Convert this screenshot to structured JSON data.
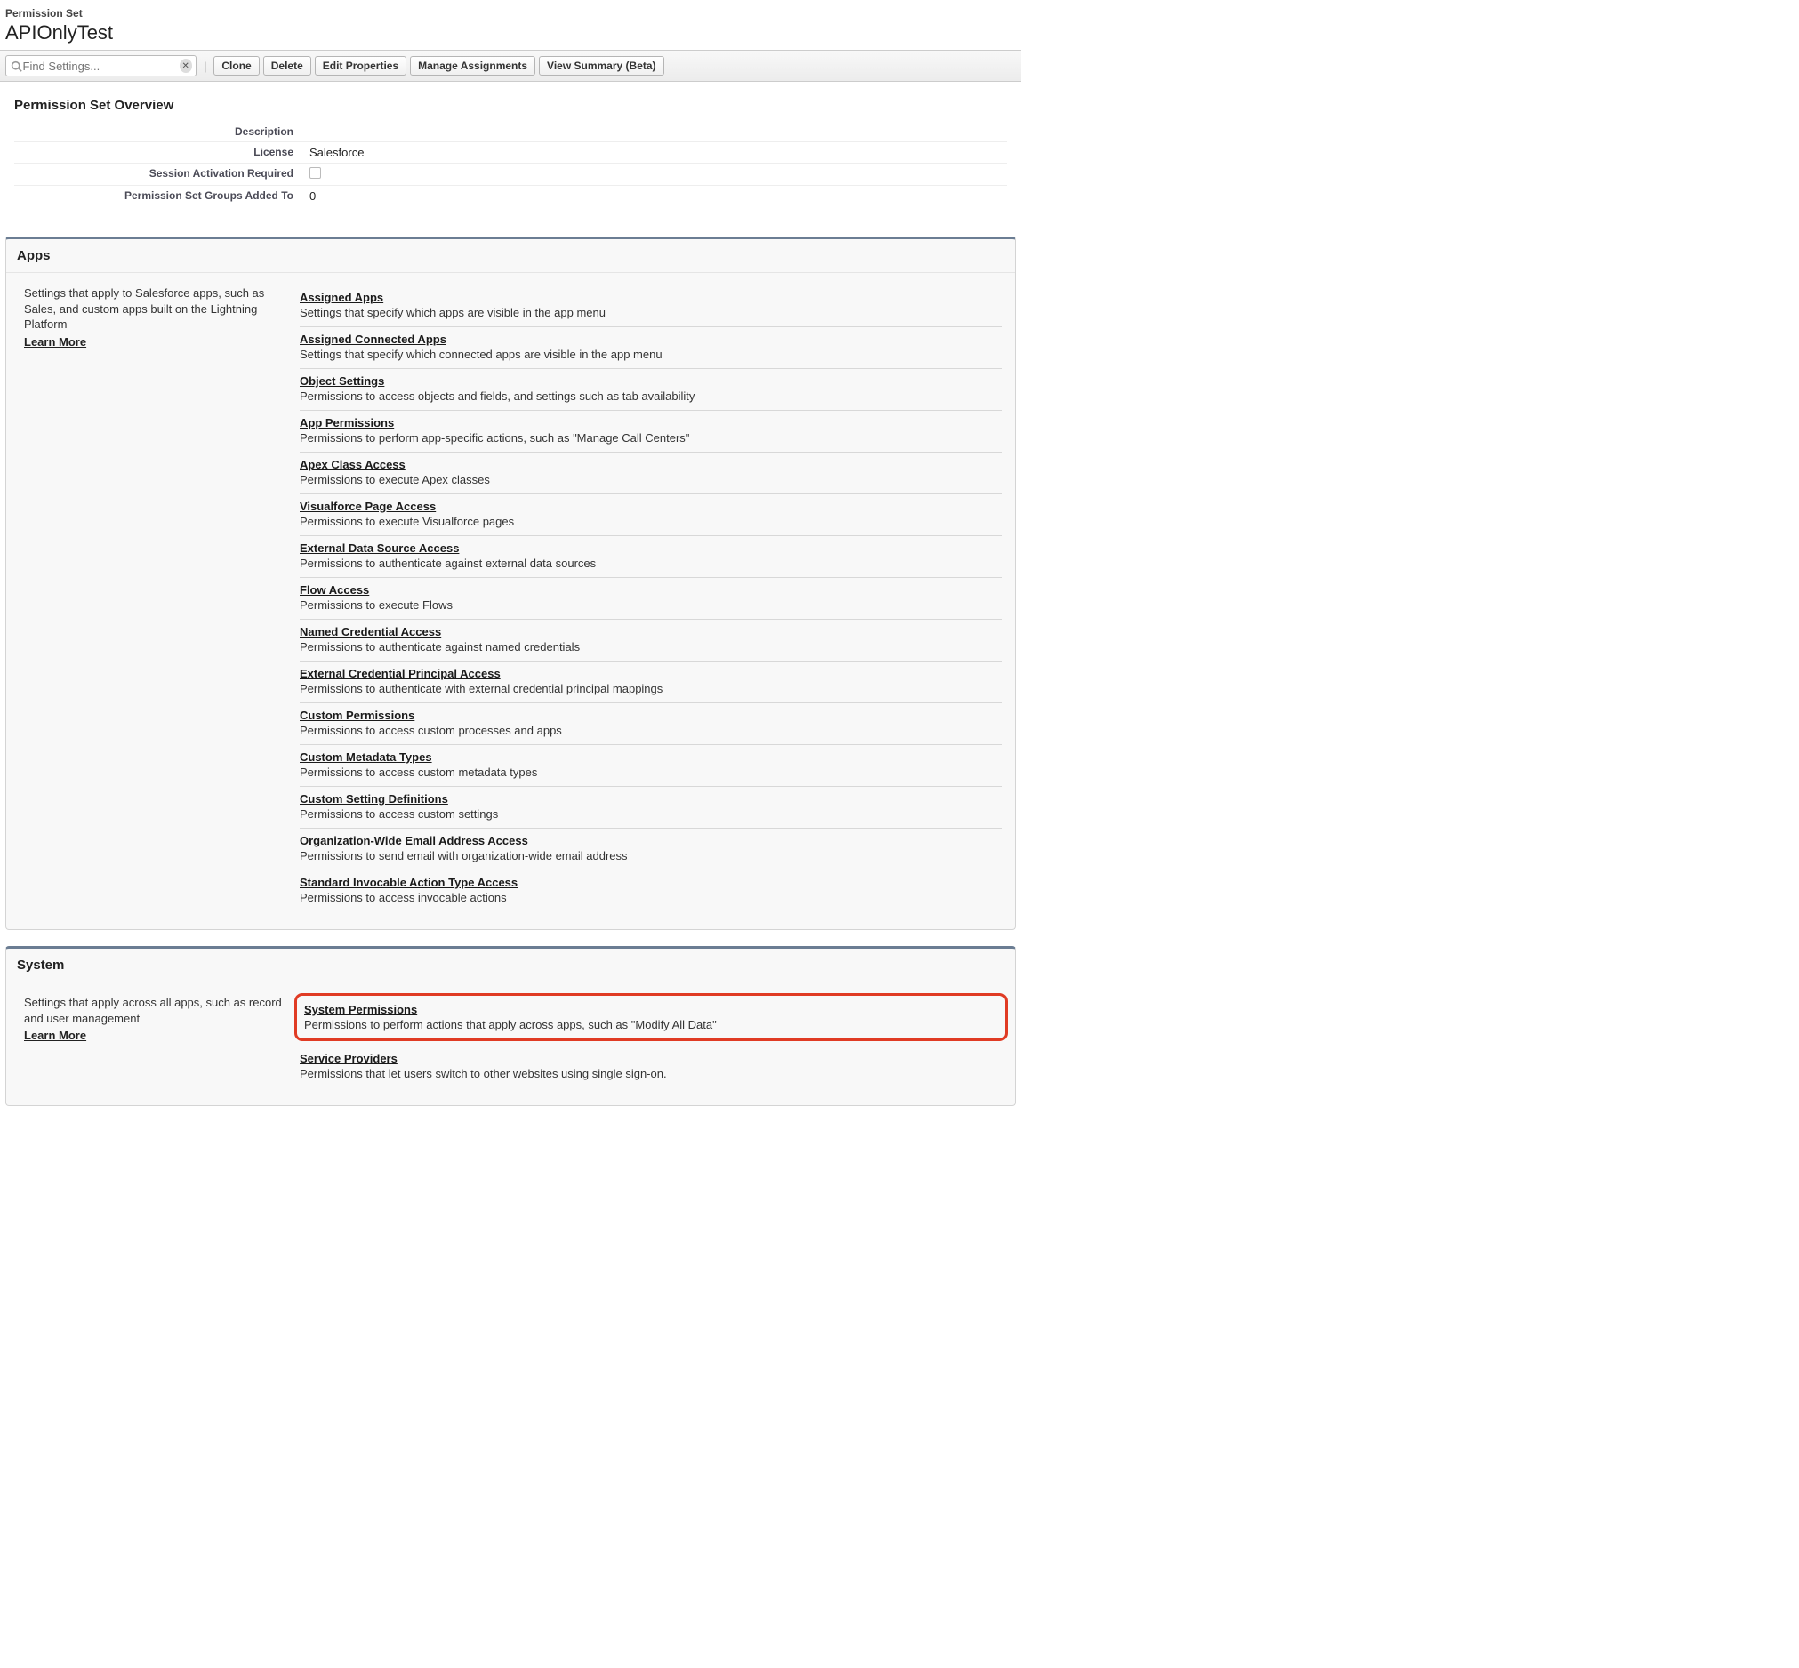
{
  "header": {
    "type_label": "Permission Set",
    "title": "APIOnlyTest"
  },
  "search": {
    "placeholder": "Find Settings..."
  },
  "toolbar": {
    "clone": "Clone",
    "delete": "Delete",
    "edit_properties": "Edit Properties",
    "manage_assignments": "Manage Assignments",
    "view_summary": "View Summary (Beta)"
  },
  "overview": {
    "heading": "Permission Set Overview",
    "rows": {
      "description_label": "Description",
      "description_value": "",
      "license_label": "License",
      "license_value": "Salesforce",
      "session_label": "Session Activation Required",
      "groups_label": "Permission Set Groups Added To",
      "groups_value": "0"
    }
  },
  "apps_section": {
    "heading": "Apps",
    "desc": "Settings that apply to Salesforce apps, such as Sales, and custom apps built on the Lightning Platform",
    "learn_more": "Learn More",
    "items": [
      {
        "title": "Assigned Apps",
        "desc": "Settings that specify which apps are visible in the app menu"
      },
      {
        "title": "Assigned Connected Apps",
        "desc": "Settings that specify which connected apps are visible in the app menu"
      },
      {
        "title": "Object Settings",
        "desc": "Permissions to access objects and fields, and settings such as tab availability"
      },
      {
        "title": "App Permissions",
        "desc": "Permissions to perform app-specific actions, such as \"Manage Call Centers\""
      },
      {
        "title": "Apex Class Access",
        "desc": "Permissions to execute Apex classes"
      },
      {
        "title": "Visualforce Page Access",
        "desc": "Permissions to execute Visualforce pages"
      },
      {
        "title": "External Data Source Access",
        "desc": "Permissions to authenticate against external data sources"
      },
      {
        "title": "Flow Access",
        "desc": "Permissions to execute Flows"
      },
      {
        "title": "Named Credential Access",
        "desc": "Permissions to authenticate against named credentials"
      },
      {
        "title": "External Credential Principal Access",
        "desc": "Permissions to authenticate with external credential principal mappings"
      },
      {
        "title": "Custom Permissions",
        "desc": "Permissions to access custom processes and apps"
      },
      {
        "title": "Custom Metadata Types",
        "desc": "Permissions to access custom metadata types"
      },
      {
        "title": "Custom Setting Definitions",
        "desc": "Permissions to access custom settings"
      },
      {
        "title": "Organization-Wide Email Address Access",
        "desc": "Permissions to send email with organization-wide email address"
      },
      {
        "title": "Standard Invocable Action Type Access",
        "desc": "Permissions to access invocable actions"
      }
    ]
  },
  "system_section": {
    "heading": "System",
    "desc": "Settings that apply across all apps, such as record and user management",
    "learn_more": "Learn More",
    "items": [
      {
        "title": "System Permissions",
        "desc": "Permissions to perform actions that apply across apps, such as \"Modify All Data\"",
        "highlight": true
      },
      {
        "title": "Service Providers",
        "desc": "Permissions that let users switch to other websites using single sign-on."
      }
    ]
  }
}
